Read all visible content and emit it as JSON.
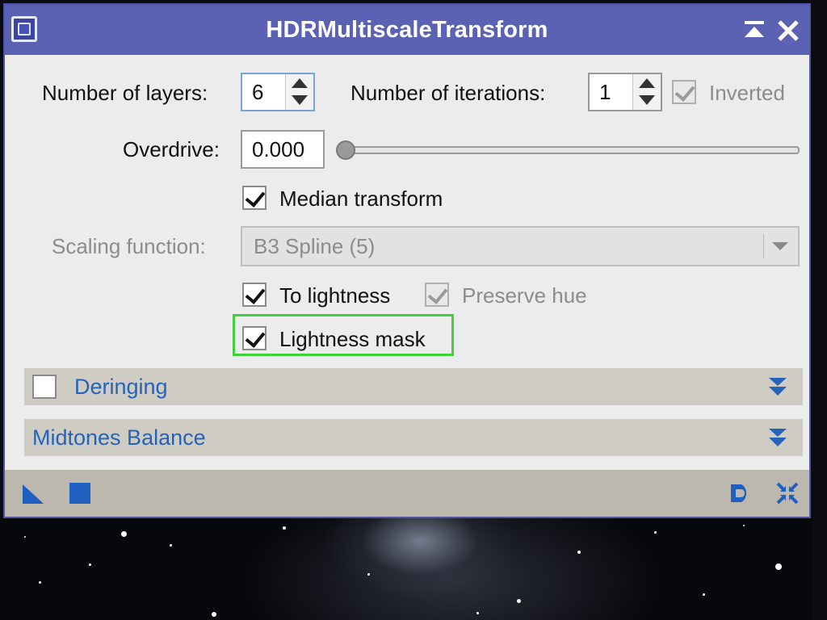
{
  "window": {
    "title": "HDRMultiscaleTransform"
  },
  "params": {
    "layers_label": "Number of layers:",
    "layers_value": "6",
    "iterations_label": "Number of iterations:",
    "iterations_value": "1",
    "inverted_label": "Inverted",
    "inverted_checked": true,
    "overdrive_label": "Overdrive:",
    "overdrive_value": "0.000",
    "overdrive_slider_fraction": 0.0,
    "median_transform_label": "Median transform",
    "median_transform_checked": true,
    "scaling_function_label": "Scaling function:",
    "scaling_function_value": "B3 Spline (5)",
    "to_lightness_label": "To lightness",
    "to_lightness_checked": true,
    "preserve_hue_label": "Preserve hue",
    "preserve_hue_checked": true,
    "lightness_mask_label": "Lightness mask",
    "lightness_mask_checked": true
  },
  "sections": {
    "deringing_label": "Deringing",
    "deringing_checked": false,
    "midtones_label": "Midtones Balance"
  },
  "colors": {
    "titlebar": "#5b62b4",
    "section_text": "#2563b8",
    "highlight": "#3ed23a"
  },
  "icons": {
    "app": "process-icon",
    "shade": "shade-icon",
    "close": "close-icon",
    "new_instance": "new-instance-icon",
    "apply_global": "apply-global-icon",
    "documentation": "documentation-icon",
    "reset": "reset-icon",
    "section_toggle": "double-chevron-down-icon"
  }
}
